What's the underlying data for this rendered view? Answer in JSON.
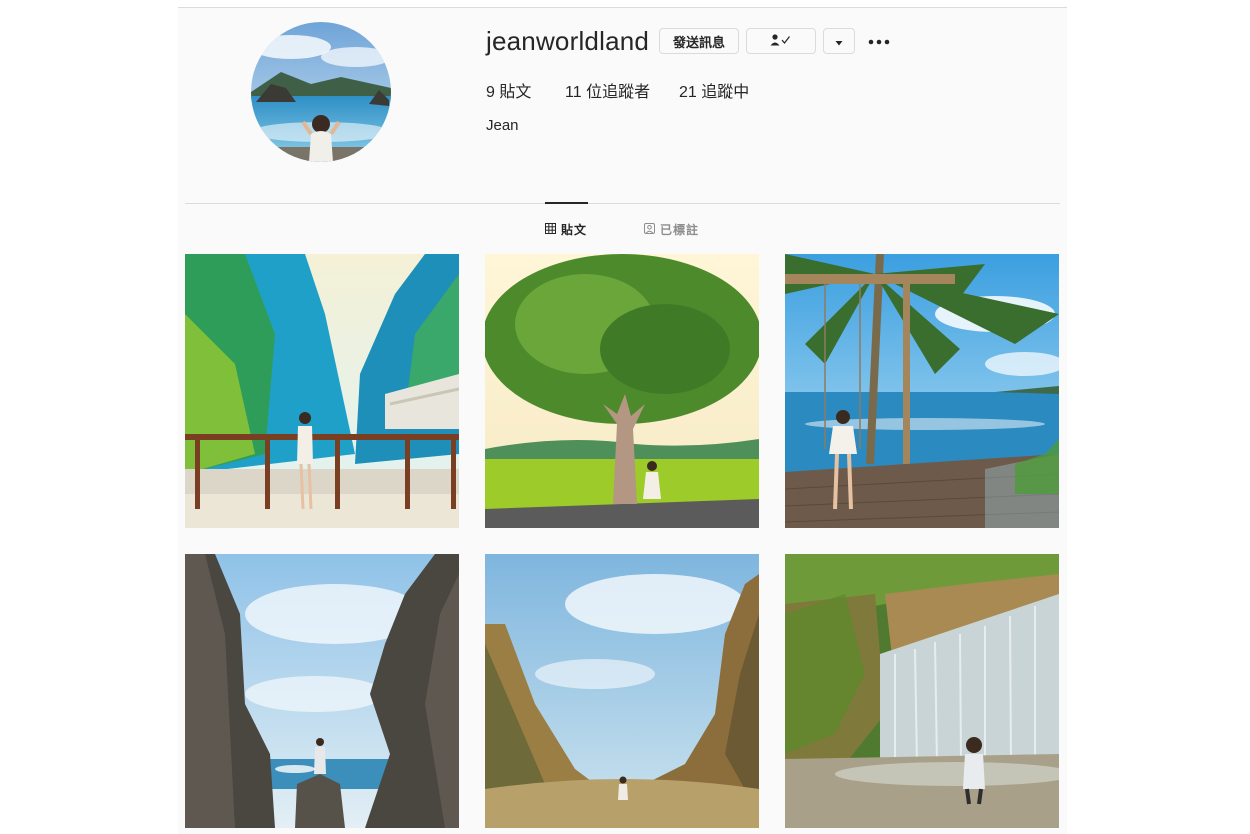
{
  "profile": {
    "username": "jeanworldland",
    "message_button": "發送訊息",
    "posts_count": "9",
    "posts_label": "貼文",
    "followers_count": "11",
    "followers_label": "位追蹤者",
    "following_count": "21",
    "following_label": "追蹤中",
    "display_name": "Jean"
  },
  "tabs": [
    {
      "label": "貼文",
      "icon": "grid-icon",
      "active": true
    },
    {
      "label": "已標註",
      "icon": "tagged-icon",
      "active": false
    }
  ],
  "posts": [
    {
      "scene": "gorge-railing"
    },
    {
      "scene": "big-tree-field"
    },
    {
      "scene": "palm-swing-sea"
    },
    {
      "scene": "rock-arch-sea"
    },
    {
      "scene": "canyon-valley"
    },
    {
      "scene": "waterfall"
    }
  ]
}
